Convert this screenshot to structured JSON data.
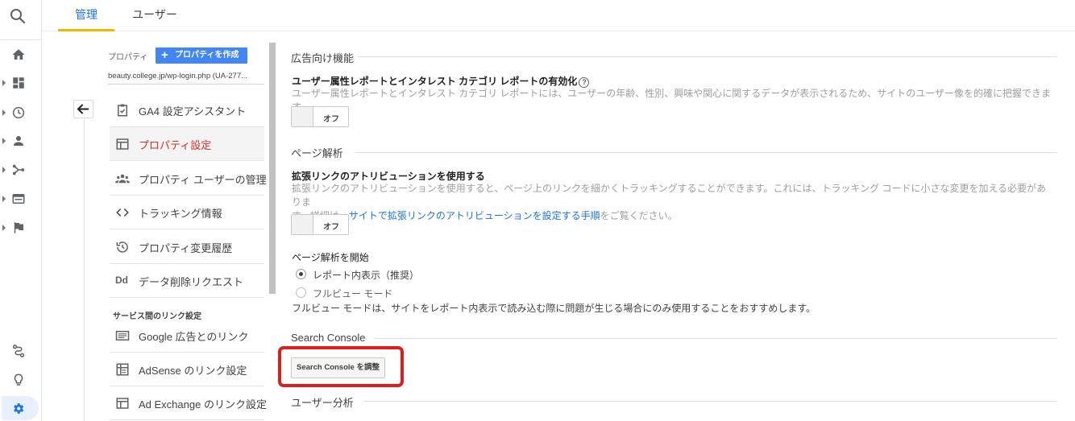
{
  "tabs": [
    {
      "label": "管理"
    },
    {
      "label": "ユーザー"
    }
  ],
  "property": {
    "label": "プロパティ",
    "create_button": "プロパティを作成",
    "url": "beauty.college.jp/wp-login.php (UA-277..."
  },
  "menu": [
    {
      "label": "GA4 設定アシスタント",
      "icon": "checklist-icon"
    },
    {
      "label": "プロパティ設定",
      "icon": "property-settings-icon",
      "selected": true
    },
    {
      "label": "プロパティ ユーザーの管理",
      "icon": "users-icon"
    },
    {
      "label": "トラッキング情報",
      "icon": "code-icon"
    },
    {
      "label": "プロパティ変更履歴",
      "icon": "history-icon"
    },
    {
      "label": "データ削除リクエスト",
      "icon": "dd-icon"
    }
  ],
  "link_section": {
    "header": "サービス間のリンク設定",
    "items": [
      {
        "label": "Google 広告とのリンク",
        "icon": "google-ads-icon"
      },
      {
        "label": "AdSense のリンク設定",
        "icon": "adsense-icon"
      },
      {
        "label": "Ad Exchange のリンク設定",
        "icon": "ad-exchange-icon"
      }
    ]
  },
  "settings": {
    "ads": {
      "title": "広告向け機能",
      "item_title": "ユーザー属性レポートとインタレスト カテゴリ レポートの有効化",
      "item_desc": "ユーザー属性レポートとインタレスト カテゴリ レポートには、ユーザーの年齢、性別、興味や関心に関するデータが表示されるため、サイトのユーザー像を的確に把握できます。",
      "toggle": "オフ"
    },
    "page_analysis": {
      "title": "ページ解析",
      "item_title": "拡張リンクのアトリビューションを使用する",
      "item_desc_1": "拡張リンクのアトリビューションを使用すると、ページ上のリンクを細かくトラッキングすることができます。これには、トラッキング コードに小さな変更を加える必要がありま",
      "item_desc_2a": "す。詳細は、",
      "item_desc_link": "サイトで拡張リンクのアトリビューションを設定する手順",
      "item_desc_2b": "をご覧ください。",
      "toggle": "オフ",
      "start_title": "ページ解析を開始",
      "radio_1": "レポート内表示（推奨）",
      "radio_2": "フルビュー モード",
      "note": "フルビュー モードは、サイトをレポート内表示で読み込む際に問題が生じる場合にのみ使用することをおすすめします。"
    },
    "search_console": {
      "title": "Search Console",
      "button": "Search Console を調整"
    },
    "user_analysis": {
      "title": "ユーザー分析"
    }
  },
  "colors": {
    "accent": "#1a73e8",
    "tab_underline": "#f4b400",
    "selected_item": "#d93025",
    "highlight_box": "#e01d1d",
    "create_button": "#4285f4"
  }
}
